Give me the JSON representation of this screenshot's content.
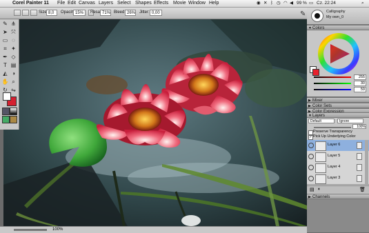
{
  "menubar": {
    "app_name": "Corel Painter 11",
    "items": [
      "File",
      "Edit",
      "Canvas",
      "Layers",
      "Select",
      "Shapes",
      "Effects",
      "Movie",
      "Window",
      "Help"
    ],
    "battery": "99 %",
    "clock": "Cz. 22:24"
  },
  "property_bar": {
    "size_label": "Size:",
    "size_value": "8,0",
    "opacity_label": "Opacity:",
    "opacity_value": "15%",
    "resat_label": "Resat:",
    "resat_value": "71%",
    "bleed_label": "Bleed:",
    "bleed_value": "26%",
    "jitter_label": "Jitter:",
    "jitter_value": "0,00"
  },
  "brush_selector": {
    "category": "Calligraphy",
    "variant": "My own_0"
  },
  "colors_panel": {
    "title": "Colors",
    "values": [
      "255",
      "30",
      "59"
    ],
    "primary_color": "#e8202c",
    "secondary_color": "#ffffff"
  },
  "collapsed_panels": [
    "Mixer",
    "Color Sets",
    "Color Expression"
  ],
  "layers_panel": {
    "title": "Layers",
    "composite_method": "Default",
    "composite_depth": "Ignore",
    "opacity": "100%",
    "checkboxes": [
      {
        "label": "Preserve Transparency",
        "checked": false
      },
      {
        "label": "Pick Up Underlying Color",
        "checked": true
      }
    ],
    "layers": [
      {
        "name": "Layer 6",
        "selected": true
      },
      {
        "name": "Layer 5",
        "selected": false
      },
      {
        "name": "Layer 4",
        "selected": false
      },
      {
        "name": "Layer 3",
        "selected": false
      }
    ]
  },
  "channels_panel": {
    "title": "Channels"
  },
  "status": {
    "zoom": "100%"
  },
  "toolbox": {
    "primary_color": "#d42030",
    "secondary_color": "#ffffff",
    "tools": [
      "brush-icon",
      "dropper-icon",
      "layer-adjuster-icon",
      "transform-icon",
      "rectangle-select-icon",
      "lasso-icon",
      "crop-icon",
      "magic-wand-icon",
      "pen-icon",
      "shape-icon",
      "text-icon",
      "eraser-icon",
      "paint-bucket-icon",
      "dodge-icon",
      "grabber-icon",
      "magnifier-icon",
      "rotate-icon",
      "mirror-icon"
    ]
  }
}
